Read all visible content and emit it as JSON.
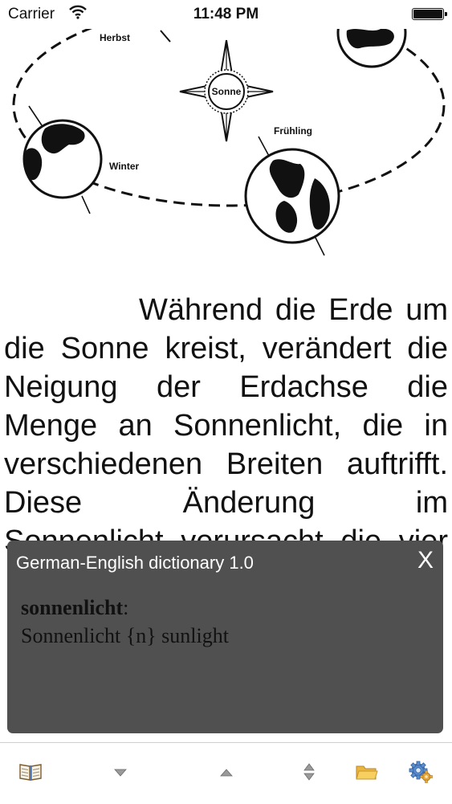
{
  "status_bar": {
    "carrier": "Carrier",
    "time": "11:48 PM"
  },
  "illustration": {
    "labels": {
      "sun": "Sonne",
      "autumn": "Herbst",
      "winter": "Winter",
      "spring": "Frühling"
    }
  },
  "article": {
    "lines": [
      "Während die Erde um",
      "die Sonne kreist, verändert die",
      "Neigung der Erdachse die",
      "Menge an Sonnenlicht, die in",
      "verschiedenen Breiten auftrifft.",
      "Diese Änderung im",
      "Sonnenlicht verursacht die vier"
    ]
  },
  "dictionary_popup": {
    "title": "German-English dictionary 1.0",
    "close_label": "X",
    "headword": "sonnenlicht",
    "separator": ":",
    "definition": "Sonnenlicht {n} sunlight"
  },
  "toolbar": {
    "icons": [
      "book-icon",
      "arrow-down-icon",
      "arrow-up-icon",
      "expand-icon",
      "folder-icon",
      "settings-gear-icon"
    ]
  }
}
